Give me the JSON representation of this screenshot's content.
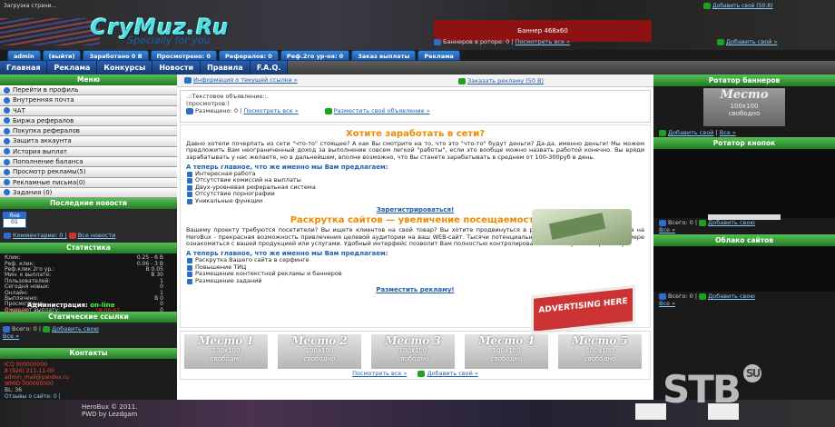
{
  "header": {
    "top_text": "Загрузка страни...",
    "site_name": "CryMuz.Ru",
    "slogan": "Specially for you",
    "banner": "Баннер 468x60",
    "add_site_top": "Добавить свой (50.8)",
    "rotator_text": "Баннеров в роторе: 0 |",
    "rotator_link": "Посмотреть все »",
    "add_banner": "Добавить свой »"
  },
  "tabs": [
    "admin",
    "(выйти)",
    "Заработано 0 В",
    "Просмотрено: 0",
    "Рефералов: 0",
    "Реф.2го ур-ня: 0",
    "Заказ выплаты",
    "Реклама"
  ],
  "nav": [
    "Главная",
    "Реклама",
    "Конкурсы",
    "Новости",
    "Правила",
    "F.A.Q."
  ],
  "menu": {
    "title": "Меню",
    "items": [
      "Перейти в профиль",
      "Внутренняя почта",
      "ЧАТ",
      "Биржа рефералов",
      "Покупка рефералов",
      "Защита аккаунта",
      "История выплат",
      "Пополнение баланса",
      "Просмотр рекламы(5)",
      "Рекламные письма(0)",
      "Задания (0)"
    ]
  },
  "news": {
    "title": "Последние новости",
    "cal_month": "Янв",
    "cal_day": "01",
    "comments": "Комментарии: 0 |",
    "all": "Все новости"
  },
  "stats": {
    "title": "Статистика",
    "rows": [
      [
        "Клик:",
        "0.25 - 6 В"
      ],
      [
        "Реф. клик:",
        "0.06 - 3 В"
      ],
      [
        "Реф.клик 2го ур.:",
        "В 0.05"
      ],
      [
        "Мин. к выплате:",
        "В 30"
      ],
      [
        "Пользователей:",
        "1"
      ],
      [
        "Сегодня новых:",
        "0"
      ],
      [
        "Онлайн:",
        "1"
      ],
      [
        "Выплачено:",
        "В 0"
      ],
      [
        "Просмотрено:",
        "0"
      ],
      [
        "Ожидают выплату:",
        "0"
      ]
    ],
    "admin": "Администрация:",
    "online": "on-line",
    "d1": "12.05.11",
    "d2": "18:00:07"
  },
  "sites": {
    "title": "Статические ссылки",
    "all": "Всего: 0 |",
    "add": "Добавить свою",
    "more": "Все »"
  },
  "contacts": {
    "title": "Контакты",
    "lines": [
      "ICQ 000000000",
      "8 (926) 211-11-00",
      "admin_mail@yandex.ru",
      "WMID 000000000",
      "BL: 36",
      "Отзывы о сайте: 0 |"
    ]
  },
  "center": {
    "text_link": "Информация о текущей ссылке »",
    "order": "Заказать рекламу (50 В)",
    "txtad_title": ".::Текстовое объявление::.",
    "viewed": "(просмотров:)",
    "placed": "Размещено: 0 |",
    "see_all": "Посмотреть все »",
    "place_ad": "Разместить своё объявление »"
  },
  "promo": {
    "h1": "Хотите заработать в сети?",
    "p1": "Давно хотели почерпать из сети \"что-то\" стоящее? А как Вы смотрите на то, что это \"что-то\" будут деньги? Да-да, именно деньги! Мы можем предложить Вам неограниченный доход за выполнение совсем легкой \"работы\", если это вообще можно назвать работой конечно. Вы вряди зарабатывать у нас желаете, но в дальнейшем, вполне возможно, что Вы станете зарабатывать в среднем от 100-300руб в день.",
    "lead1": "А теперь главное, что же именно мы Вам предлагаем:",
    "list1": [
      "Интересная работа",
      "Отсутствие комиссий на выплаты",
      "Двух-уровневая реферальная система",
      "Отсутствие порнографии",
      "Уникальные функции"
    ],
    "cta1": "Зарегистрироваться!",
    "h2": "Раскрутка сайтов — увеличение посещаемости",
    "p2": "Вашему проекту требуются посетители? Вы ищете клиентов на свой товар? Вы хотите продвинуться в рейтинге поисковиков? Реклама на HeroBux - прекрасная возможность привлечения целевой аудитории на ваш WEB-сайт. Тысячи потенциальных клиентов смогут в полной мере ознакомиться с вашей продукцией или услугами. Удобный интерфейс позволит Вам полностью контролировать заказанную Вами рекламу.",
    "lead2": "А теперь главное, что же именно мы Вам предлагаем:",
    "list2": [
      "Раскрутка Вашего сайта в серфинге",
      "Повышение ТИЦ",
      "Размещение контекстной рекламы и баннеров",
      "Размещение заданий"
    ],
    "cta2": "Разместить рекламу!",
    "board": "ADVERTISING HERE"
  },
  "places": {
    "items": [
      "Место 1",
      "Место 2",
      "Место 3",
      "Место 4",
      "Место 5"
    ],
    "size": "100x100",
    "free": "свободно",
    "see_all": "Посмотреть все »",
    "add": "Добавить свой »"
  },
  "right": {
    "rot1": "Ротатор баннеров",
    "place": "Место",
    "size": "100x100",
    "free": "свободно",
    "add": "Добавить свой",
    "all": "Все »",
    "rot2": "Ротатор кнопок",
    "total": "Всего: 0 |",
    "add2": "Добавить свою",
    "more": "Все »",
    "cloud": "Облако сайтов",
    "total2": "Всего: 0 |",
    "add3": "Добавить свою",
    "more2": "Все »"
  },
  "footer": {
    "copy": "HeroBux © 2011.",
    "pwd": "PWD by Lezdgam"
  },
  "watermark": "STB",
  "wm_su": "SU"
}
